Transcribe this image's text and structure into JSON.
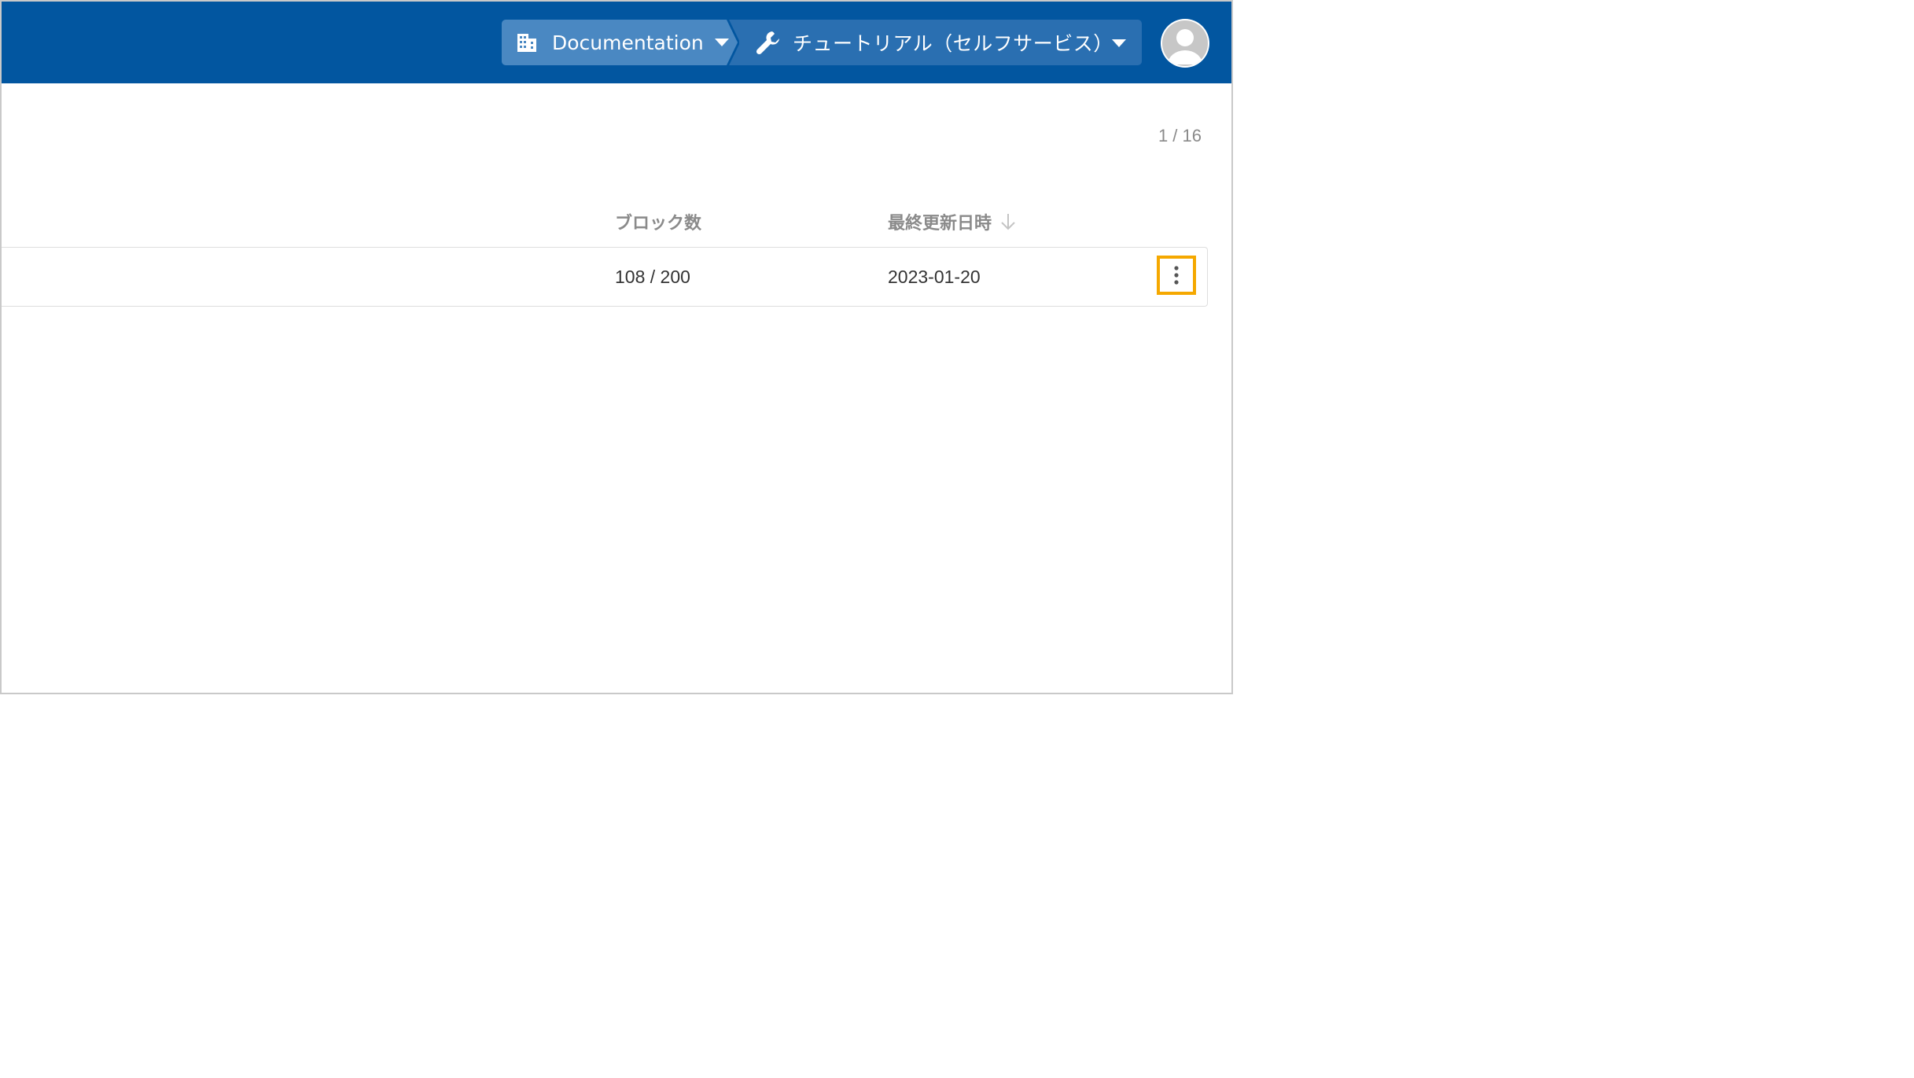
{
  "header": {
    "workspace": {
      "label": "Documentation",
      "icon": "building-icon"
    },
    "project": {
      "label": "チュートリアル（セルフサービス）",
      "icon": "wrench-icon"
    },
    "avatar": {
      "icon": "user-avatar-icon"
    }
  },
  "pagination": {
    "label": "1 / 16"
  },
  "table": {
    "columns": [
      {
        "label": "ブロック数"
      },
      {
        "label": "最終更新日時",
        "sort_icon": "arrow-down-icon"
      }
    ],
    "rows": [
      {
        "blocks": "108 / 200",
        "updated": "2023-01-20",
        "menu_icon": "kebab-menu-icon"
      }
    ]
  },
  "colors": {
    "topbar": "#0256a0",
    "workspace_crumb": "#4a88c2",
    "project_crumb": "#2a6fb1",
    "highlight": "#f5a800"
  }
}
